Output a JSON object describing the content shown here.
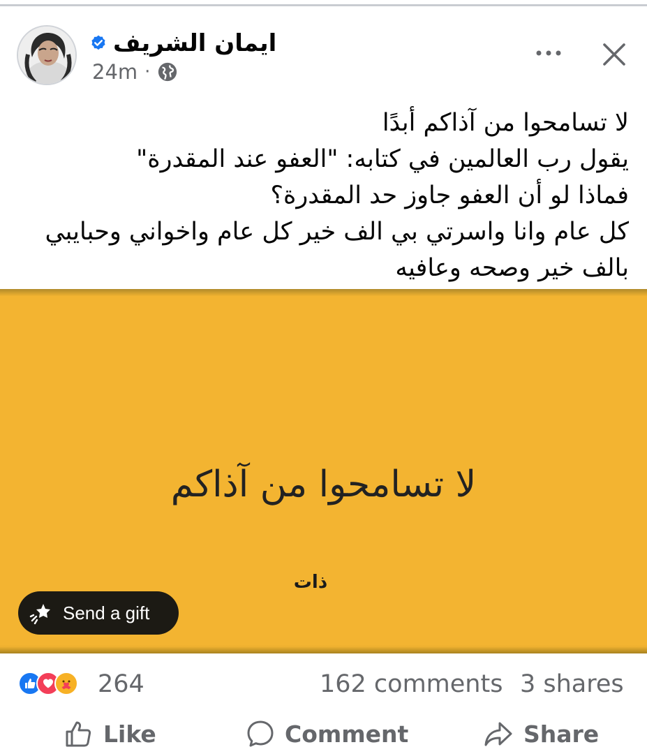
{
  "post": {
    "author": "ايمان الشريف",
    "timestamp": "24m",
    "separator": "·",
    "text_lines": [
      "لا تسامحوا من آذاكم أبدًا",
      "يقول رب العالمين في كتابه: \"العفو عند المقدرة\"",
      "فماذا لو أن العفو جاوز حد المقدرة؟",
      "كل عام وانا واسرتي بي الف خير كل عام واخواني وحبايبي",
      "بالف خير وصحه وعافيه"
    ]
  },
  "media": {
    "title": "لا تسامحوا من آذاكم",
    "brand": "ذات",
    "background_color": "#f3b431"
  },
  "gift": {
    "label": "Send a gift",
    "icon": "gift-sparkle-icon"
  },
  "stats": {
    "reaction_icons": [
      "like-reaction-icon",
      "love-reaction-icon",
      "care-reaction-icon"
    ],
    "reactions": "264",
    "comments": "162 comments",
    "shares": "3 shares"
  },
  "actions": {
    "like": "Like",
    "comment": "Comment",
    "share": "Share"
  },
  "colors": {
    "verified": "#1877f2",
    "secondary_text": "#65676b",
    "like_blue": "#1877f2",
    "love_red": "#f33e58"
  }
}
